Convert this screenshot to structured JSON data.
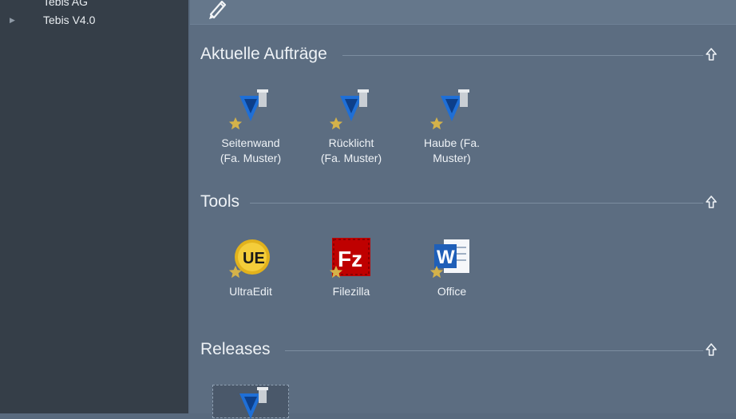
{
  "sidebar": {
    "items": [
      {
        "label": "Tebis AG"
      },
      {
        "label": "Tebis V4.0"
      }
    ]
  },
  "toolbar": {
    "edit_icon": "pencil-icon"
  },
  "sections": {
    "orders": {
      "title": "Aktuelle Aufträge",
      "tiles": [
        {
          "line1": "Seitenwand",
          "line2": "(Fa. Muster)",
          "icon": "tebis-icon"
        },
        {
          "line1": "Rücklicht",
          "line2": "(Fa. Muster)",
          "icon": "tebis-icon"
        },
        {
          "line1": "Haube (Fa.",
          "line2": "Muster)",
          "icon": "tebis-icon"
        }
      ]
    },
    "tools": {
      "title": "Tools",
      "tiles": [
        {
          "label": "UltraEdit",
          "icon": "ultraedit-icon"
        },
        {
          "label": "Filezilla",
          "icon": "filezilla-icon"
        },
        {
          "label": "Office",
          "icon": "word-icon"
        }
      ]
    },
    "releases": {
      "title": "Releases"
    }
  },
  "colors": {
    "sidebar_bg": "#353e48",
    "main_bg": "#5c6d81",
    "accent_blue": "#1f6fd6",
    "star_gold": "#d4b24a"
  }
}
